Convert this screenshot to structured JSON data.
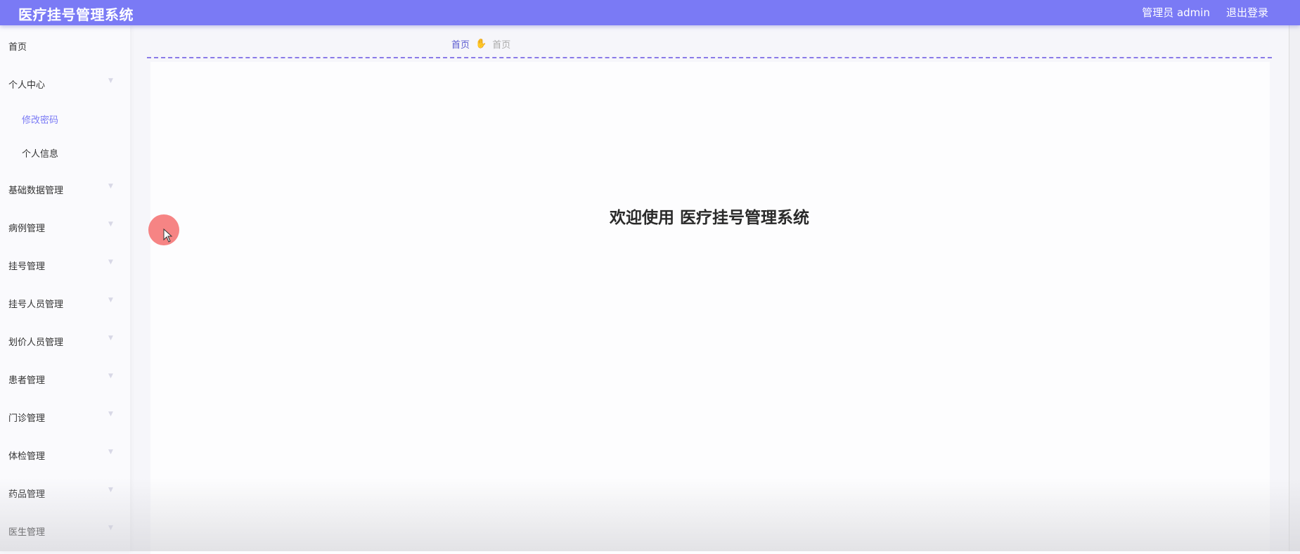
{
  "header": {
    "title": "医疗挂号管理系统",
    "user_label": "管理员 admin",
    "logout_label": "退出登录"
  },
  "sidebar": {
    "items": [
      {
        "label": "首页",
        "has_arrow": false
      },
      {
        "label": "个人中心",
        "has_arrow": true
      },
      {
        "label": "修改密码",
        "sub": true,
        "active": true
      },
      {
        "label": "个人信息",
        "sub": true
      },
      {
        "label": "基础数据管理",
        "has_arrow": true
      },
      {
        "label": "病例管理",
        "has_arrow": true
      },
      {
        "label": "挂号管理",
        "has_arrow": true
      },
      {
        "label": "挂号人员管理",
        "has_arrow": true
      },
      {
        "label": "划价人员管理",
        "has_arrow": true
      },
      {
        "label": "患者管理",
        "has_arrow": true
      },
      {
        "label": "门诊管理",
        "has_arrow": true
      },
      {
        "label": "体检管理",
        "has_arrow": true
      },
      {
        "label": "药品管理",
        "has_arrow": true
      },
      {
        "label": "医生管理",
        "has_arrow": true
      }
    ]
  },
  "breadcrumb": {
    "home": "首页",
    "separator_icon": "hand-icon",
    "current": "首页"
  },
  "main": {
    "welcome_text": "欢迎使用 医疗挂号管理系统"
  },
  "colors": {
    "accent": "#7a7af5",
    "breadcrumb_link": "#5a5ad0",
    "cursor_highlight": "#f56e6e"
  }
}
